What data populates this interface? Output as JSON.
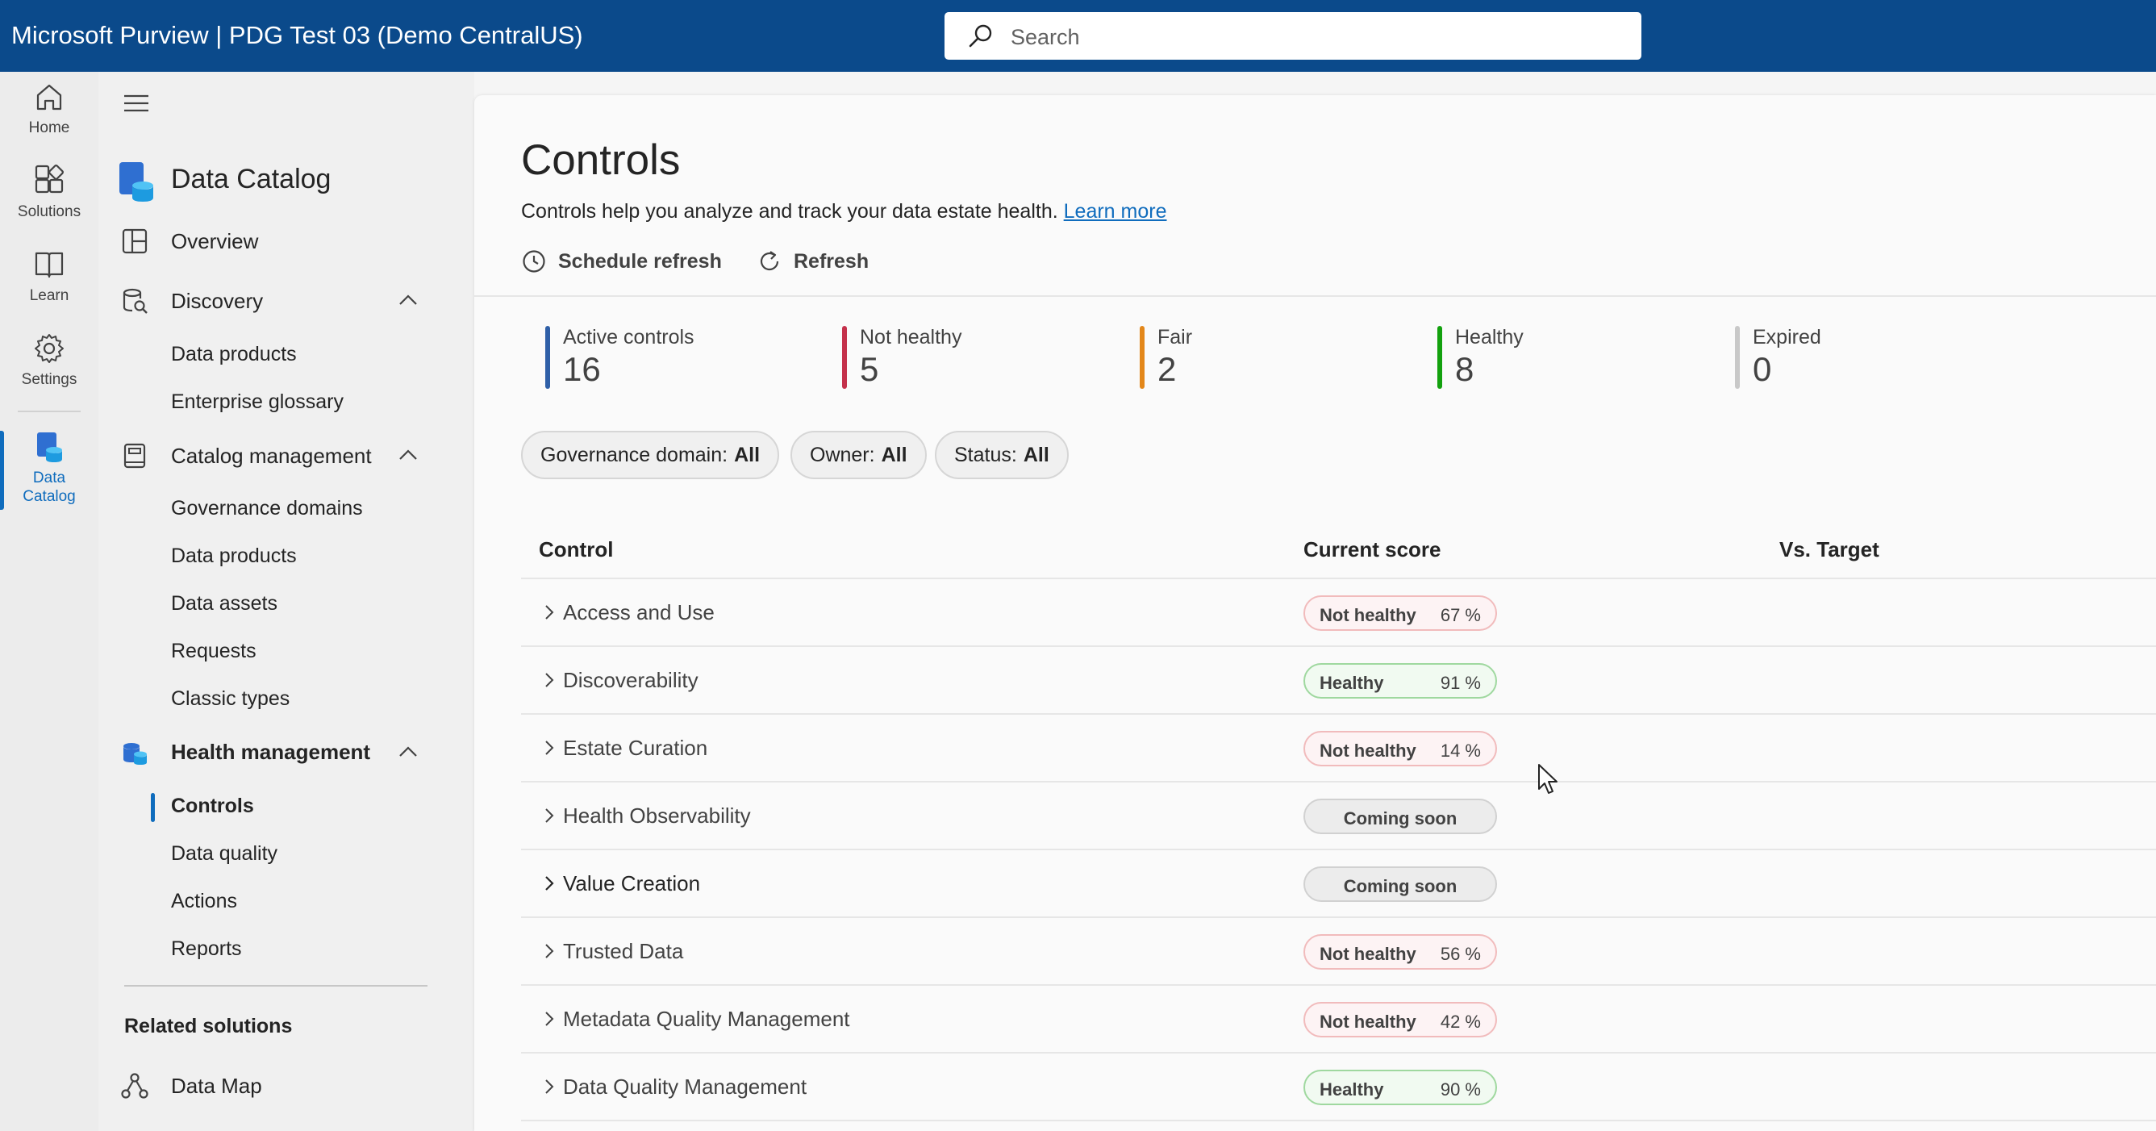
{
  "app": {
    "title": "Microsoft Purview | PDG Test 03 (Demo CentralUS)"
  },
  "search": {
    "placeholder": "Search"
  },
  "rail": {
    "items": [
      {
        "label": "Home",
        "icon": "home-icon"
      },
      {
        "label": "Solutions",
        "icon": "solutions-icon"
      },
      {
        "label": "Learn",
        "icon": "book-icon"
      },
      {
        "label": "Settings",
        "icon": "gear-icon"
      }
    ],
    "active": {
      "line1": "Data",
      "line2": "Catalog",
      "icon": "data-catalog-icon"
    }
  },
  "nav": {
    "title": "Data Catalog",
    "overview": "Overview",
    "discovery": {
      "label": "Discovery",
      "items": [
        "Data products",
        "Enterprise glossary"
      ]
    },
    "catalog_management": {
      "label": "Catalog management",
      "items": [
        "Governance domains",
        "Data products",
        "Data assets",
        "Requests",
        "Classic types"
      ]
    },
    "health_management": {
      "label": "Health management",
      "items": [
        "Controls",
        "Data quality",
        "Actions",
        "Reports"
      ]
    },
    "related_title": "Related solutions",
    "data_map": "Data Map"
  },
  "page": {
    "title": "Controls",
    "description": "Controls help you analyze and track your data estate health.",
    "learn_more": "Learn more",
    "schedule_refresh": "Schedule refresh",
    "refresh": "Refresh"
  },
  "kpis": [
    {
      "label": "Active controls",
      "value": "16",
      "color": "#2f5fa7"
    },
    {
      "label": "Not healthy",
      "value": "5",
      "color": "#c4314b"
    },
    {
      "label": "Fair",
      "value": "2",
      "color": "#e3871a"
    },
    {
      "label": "Healthy",
      "value": "8",
      "color": "#13a10e"
    },
    {
      "label": "Expired",
      "value": "0",
      "color": "#c8c8c8"
    }
  ],
  "filters": [
    {
      "label": "Governance domain:",
      "value": "All"
    },
    {
      "label": "Owner:",
      "value": "All"
    },
    {
      "label": "Status:",
      "value": "All"
    }
  ],
  "table": {
    "columns": [
      "Control",
      "Current score",
      "Vs. Target"
    ],
    "rows": [
      {
        "name": "Access and Use",
        "status": "Not healthy",
        "score": "67 %"
      },
      {
        "name": "Discoverability",
        "status": "Healthy",
        "score": "91 %"
      },
      {
        "name": "Estate Curation",
        "status": "Not healthy",
        "score": "14 %"
      },
      {
        "name": "Health Observability",
        "status": "Coming soon",
        "score": ""
      },
      {
        "name": "Value Creation",
        "status": "Coming soon",
        "score": ""
      },
      {
        "name": "Trusted Data",
        "status": "Not healthy",
        "score": "56 %"
      },
      {
        "name": "Metadata Quality Management",
        "status": "Not healthy",
        "score": "42 %"
      },
      {
        "name": "Data Quality Management",
        "status": "Healthy",
        "score": "90 %"
      }
    ]
  }
}
